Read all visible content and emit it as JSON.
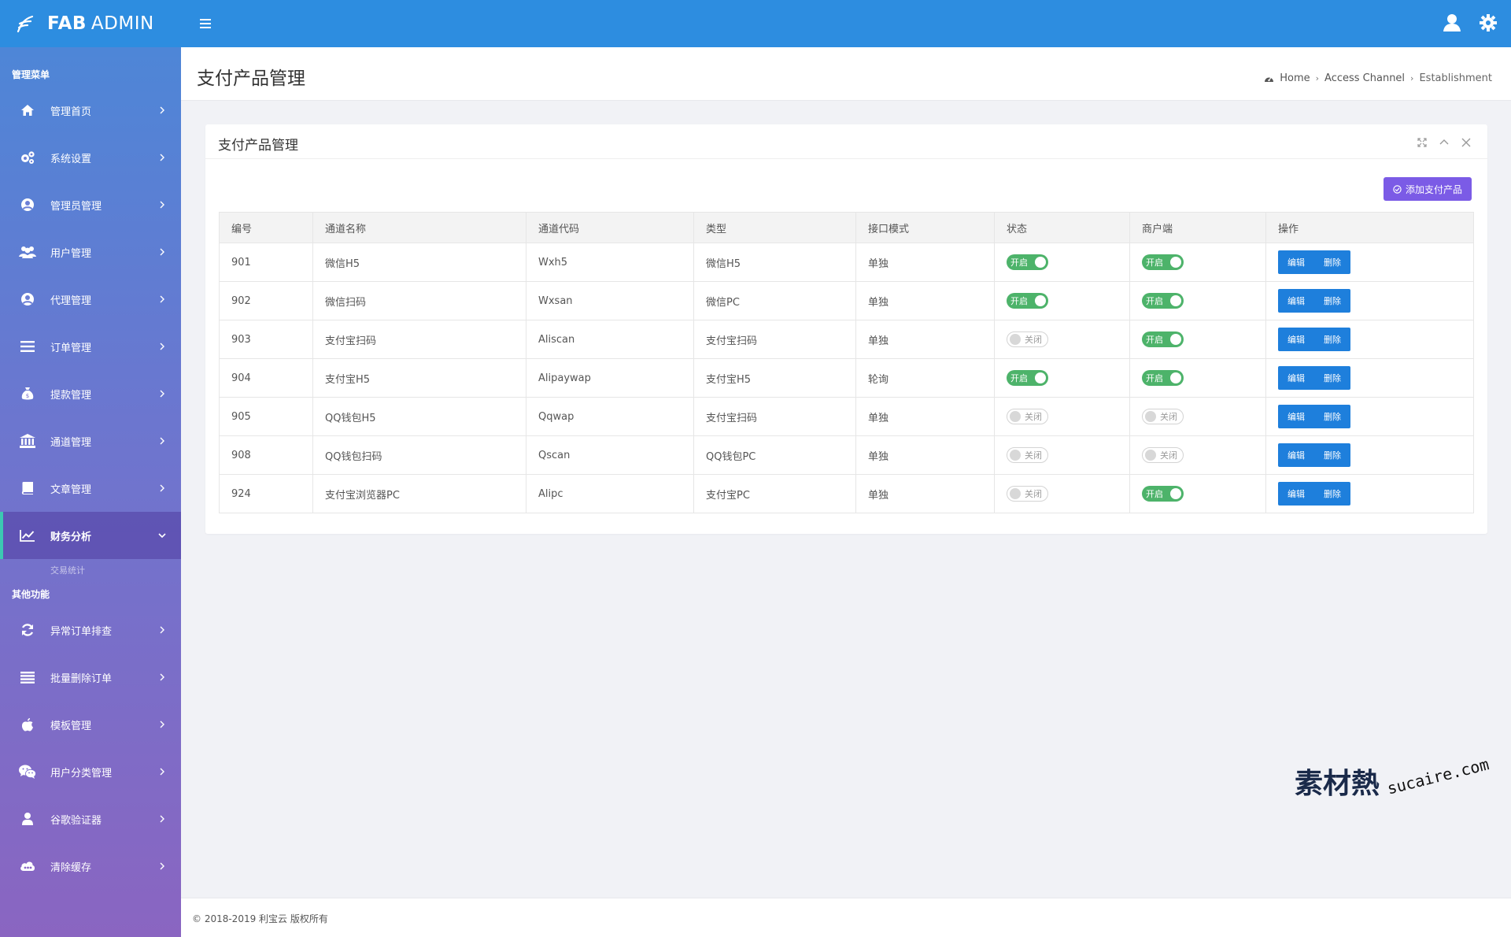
{
  "brand": {
    "bold": "FAB",
    "light": "ADMIN"
  },
  "sidebar": {
    "section_main": "管理菜单",
    "main_items": [
      {
        "label": "管理首页",
        "icon": "home-icon"
      },
      {
        "label": "系统设置",
        "icon": "cogs-icon"
      },
      {
        "label": "管理员管理",
        "icon": "user-circle-icon"
      },
      {
        "label": "用户管理",
        "icon": "users-icon"
      },
      {
        "label": "代理管理",
        "icon": "user-circle-icon"
      },
      {
        "label": "订单管理",
        "icon": "list-icon"
      },
      {
        "label": "提款管理",
        "icon": "money-bag-icon"
      },
      {
        "label": "通道管理",
        "icon": "bank-icon"
      },
      {
        "label": "文章管理",
        "icon": "book-icon"
      },
      {
        "label": "财务分析",
        "icon": "line-chart-icon"
      }
    ],
    "submenu_peek": "交易统计",
    "section_other": "其他功能",
    "other_items": [
      {
        "label": "异常订单排查",
        "icon": "refresh-icon"
      },
      {
        "label": "批量删除订单",
        "icon": "bars-icon"
      },
      {
        "label": "模板管理",
        "icon": "apple-icon"
      },
      {
        "label": "用户分类管理",
        "icon": "wechat-icon"
      },
      {
        "label": "谷歌验证器",
        "icon": "user-icon"
      },
      {
        "label": "清除缓存",
        "icon": "cloud-icon"
      }
    ]
  },
  "header": {
    "page_title": "支付产品管理",
    "breadcrumb": [
      "Home",
      "Access Channel",
      "Establishment"
    ]
  },
  "card": {
    "title": "支付产品管理",
    "add_button": "添加支付产品",
    "columns": [
      "编号",
      "通道名称",
      "通道代码",
      "类型",
      "接口模式",
      "状态",
      "商户端",
      "操作"
    ],
    "toggle_on_label": "开启",
    "toggle_off_label": "关闭",
    "edit_label": "编辑",
    "delete_label": "删除",
    "rows": [
      {
        "id": "901",
        "name": "微信H5",
        "code": "Wxh5",
        "type": "微信H5",
        "mode": "单独",
        "status": true,
        "merchant": true
      },
      {
        "id": "902",
        "name": "微信扫码",
        "code": "Wxsan",
        "type": "微信PC",
        "mode": "单独",
        "status": true,
        "merchant": true
      },
      {
        "id": "903",
        "name": "支付宝扫码",
        "code": "Aliscan",
        "type": "支付宝扫码",
        "mode": "单独",
        "status": false,
        "merchant": true
      },
      {
        "id": "904",
        "name": "支付宝H5",
        "code": "Alipaywap",
        "type": "支付宝H5",
        "mode": "轮询",
        "status": true,
        "merchant": true
      },
      {
        "id": "905",
        "name": "QQ钱包H5",
        "code": "Qqwap",
        "type": "支付宝扫码",
        "mode": "单独",
        "status": false,
        "merchant": false
      },
      {
        "id": "908",
        "name": "QQ钱包扫码",
        "code": "Qscan",
        "type": "QQ钱包PC",
        "mode": "单独",
        "status": false,
        "merchant": false
      },
      {
        "id": "924",
        "name": "支付宝浏览器PC",
        "code": "Alipc",
        "type": "支付宝PC",
        "mode": "单独",
        "status": false,
        "merchant": true
      }
    ]
  },
  "footer": {
    "text": "© 2018-2019 利宝云 版权所有"
  },
  "watermark": {
    "cn": "素材熱",
    "en": "sucaire.com"
  },
  "colors": {
    "topbar": "#2d8de0",
    "toggle_on": "#4db36a",
    "primary_button": "#1e7fdc",
    "add_button": "#7b5be6",
    "active_marker": "#3cc8b2"
  }
}
